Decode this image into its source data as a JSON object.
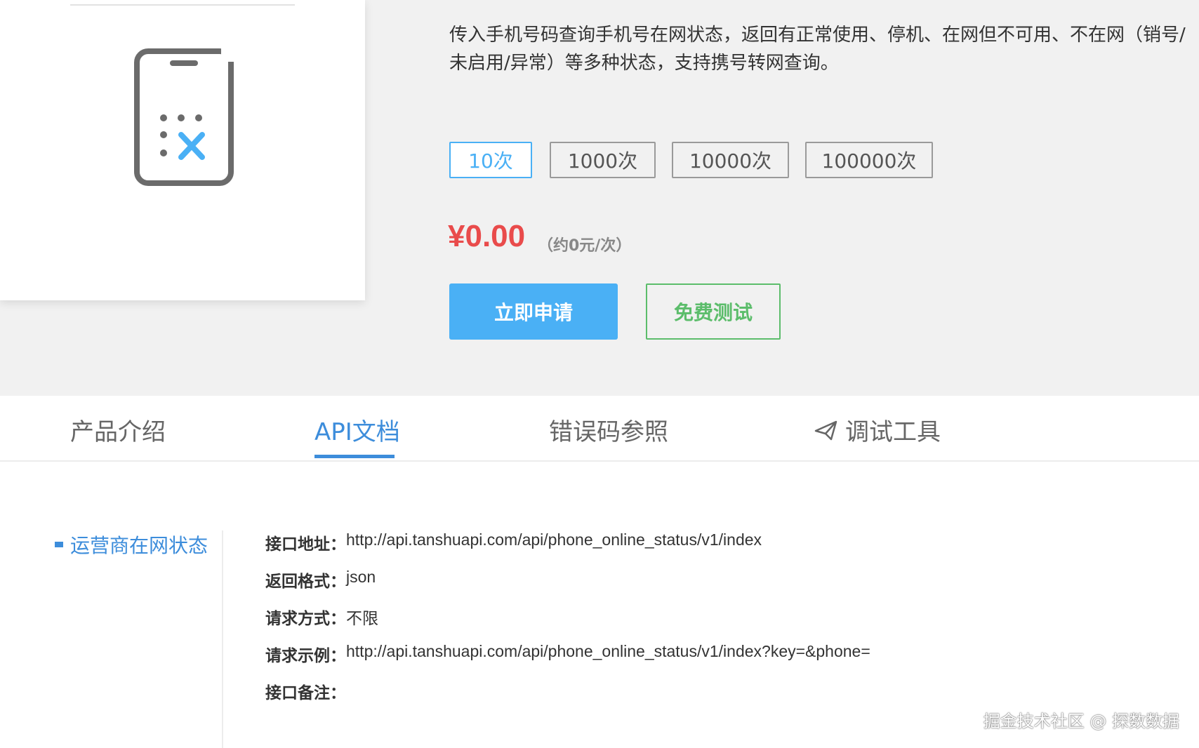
{
  "product": {
    "description": "传入手机号码查询手机号在网状态，返回有正常使用、停机、在网但不可用、不在网（销号/未启用/异常）等多种状态，支持携号转网查询。",
    "icon": "phone-x-icon"
  },
  "packages": [
    {
      "label": "10次",
      "selected": true
    },
    {
      "label": "1000次",
      "selected": false
    },
    {
      "label": "10000次",
      "selected": false
    },
    {
      "label": "100000次",
      "selected": false
    }
  ],
  "price": {
    "amount": "¥0.00",
    "unit": "（约0元/次）"
  },
  "buttons": {
    "apply": "立即申请",
    "test": "免费测试"
  },
  "tabs": [
    {
      "label": "产品介绍",
      "active": false
    },
    {
      "label": "API文档",
      "active": true
    },
    {
      "label": "错误码参照",
      "active": false
    },
    {
      "label": "调试工具",
      "active": false,
      "icon": "send-icon"
    }
  ],
  "sidebar": {
    "items": [
      {
        "label": "运营商在网状态",
        "active": true
      }
    ]
  },
  "doc": {
    "rows": [
      {
        "label": "接口地址：",
        "value": "http://api.tanshuapi.com/api/phone_online_status/v1/index"
      },
      {
        "label": "返回格式：",
        "value": "json"
      },
      {
        "label": "请求方式：",
        "value": "不限"
      },
      {
        "label": "请求示例：",
        "value": "http://api.tanshuapi.com/api/phone_online_status/v1/index?key=&phone="
      },
      {
        "label": "接口备注：",
        "value": ""
      }
    ]
  },
  "watermark": "掘金技术社区 @ 探数数据",
  "colors": {
    "accent": "#4ab0f5",
    "tab_active": "#3d8ddb",
    "price": "#e94b4b",
    "test_green": "#5cbd6b"
  }
}
